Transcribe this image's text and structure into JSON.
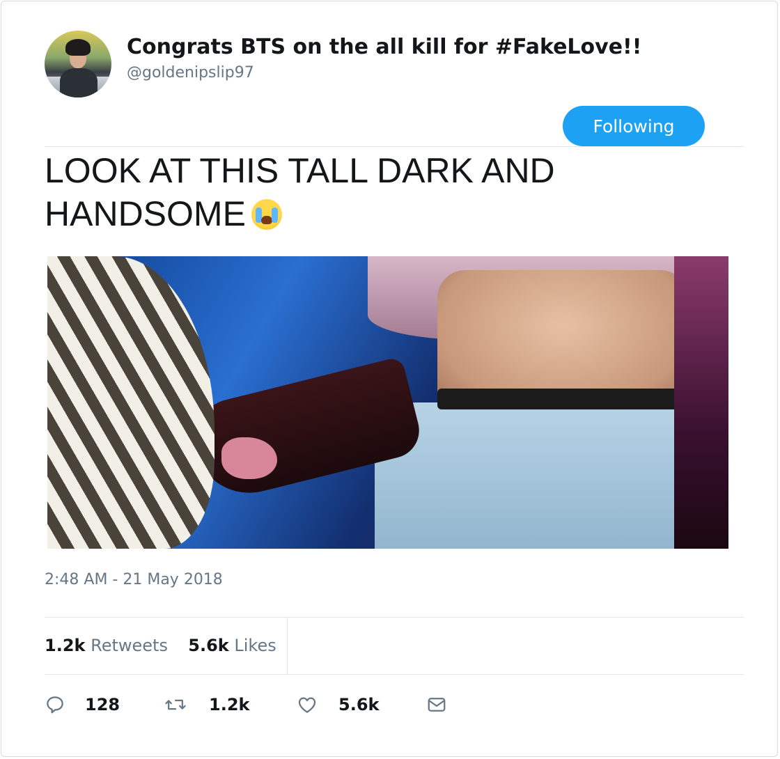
{
  "tweet": {
    "display_name": "Congrats BTS on the all kill for #FakeLove!!",
    "handle": "@goldenipslip97",
    "follow_label": "Following",
    "text_line1": "LOOK AT THIS TALL DARK AND",
    "text_line2": "HANDSOME",
    "emoji_icon": "loudly-crying-face-icon",
    "timestamp": "2:48 AM - 21 May 2018"
  },
  "stats": {
    "retweets_count": "1.2k",
    "retweets_label": "Retweets",
    "likes_count": "5.6k",
    "likes_label": "Likes"
  },
  "actions": {
    "reply_count": "128",
    "retweet_count": "1.2k",
    "like_count": "5.6k",
    "icons": [
      "reply-icon",
      "retweet-icon",
      "like-heart-icon",
      "direct-message-icon"
    ]
  },
  "colors": {
    "accent": "#1da1f2",
    "text": "#14171a",
    "muted": "#657786",
    "border": "#e1e8ed"
  }
}
